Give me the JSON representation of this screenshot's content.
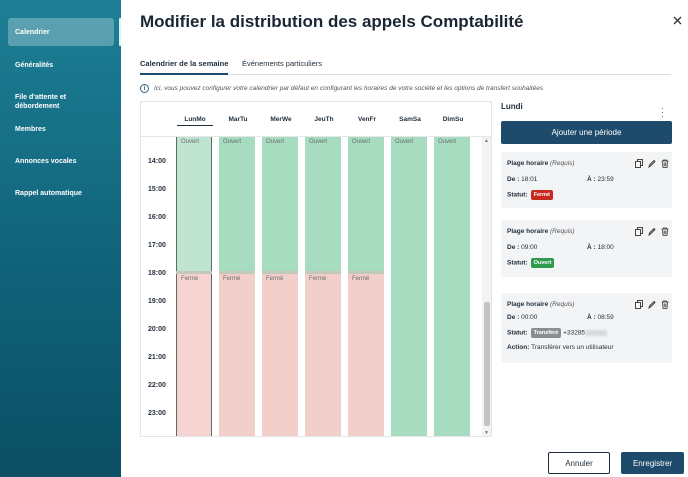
{
  "sidebar": {
    "items": [
      {
        "label": "Calendrier",
        "active": true
      },
      {
        "label": "Généralités"
      },
      {
        "label": "File d'attente et débordement"
      },
      {
        "label": "Membres"
      },
      {
        "label": "Annonces vocales"
      },
      {
        "label": "Rappel automatique"
      }
    ]
  },
  "header": {
    "title": "Modifier la distribution des appels Comptabilité",
    "close_icon": "×"
  },
  "tabs": [
    {
      "label": "Calendrier de la semaine",
      "active": true
    },
    {
      "label": "Événements particuliers"
    }
  ],
  "info_text": "Ici, vous pouvez configurer votre calendrier par défaut en configurant les horaires de votre société et les options de transfert souhaitées",
  "calendar": {
    "days": [
      "LunMo",
      "MarTu",
      "MerWe",
      "JeuTh",
      "VenFr",
      "SamSa",
      "DimSu"
    ],
    "selected_day": "LunMo",
    "hours": [
      "14:00",
      "15:00",
      "16:00",
      "17:00",
      "18:00",
      "19:00",
      "20:00",
      "21:00",
      "22:00",
      "23:00"
    ],
    "open_label": "Ouvert",
    "closed_label": "Fermé"
  },
  "panel": {
    "day_title": "Lundi",
    "add_button": "Ajouter une période",
    "slot_label": "Plage horaire",
    "required_label": "(Requis)",
    "from_label": "De :",
    "to_label": "À :",
    "status_label": "Statut:",
    "action_label": "Action:",
    "slots": [
      {
        "from": "18:01",
        "to": "23:59",
        "status": "Fermé",
        "status_color": "#c62a1f"
      },
      {
        "from": "09:00",
        "to": "18:00",
        "status": "Ouvert",
        "status_color": "#2f9a4e"
      },
      {
        "from": "00:00",
        "to": "08:59",
        "status": "Transféré",
        "status_color": "#8a8e93",
        "phone": "+33285",
        "action": "Transférer vers un utilisateur"
      }
    ]
  },
  "footer": {
    "cancel": "Annuler",
    "save": "Enregistrer"
  },
  "colors": {
    "sidebar": "#10637a",
    "primary": "#1e4a6b",
    "open": "#a7dcc1",
    "closed": "#f3cfcc"
  }
}
